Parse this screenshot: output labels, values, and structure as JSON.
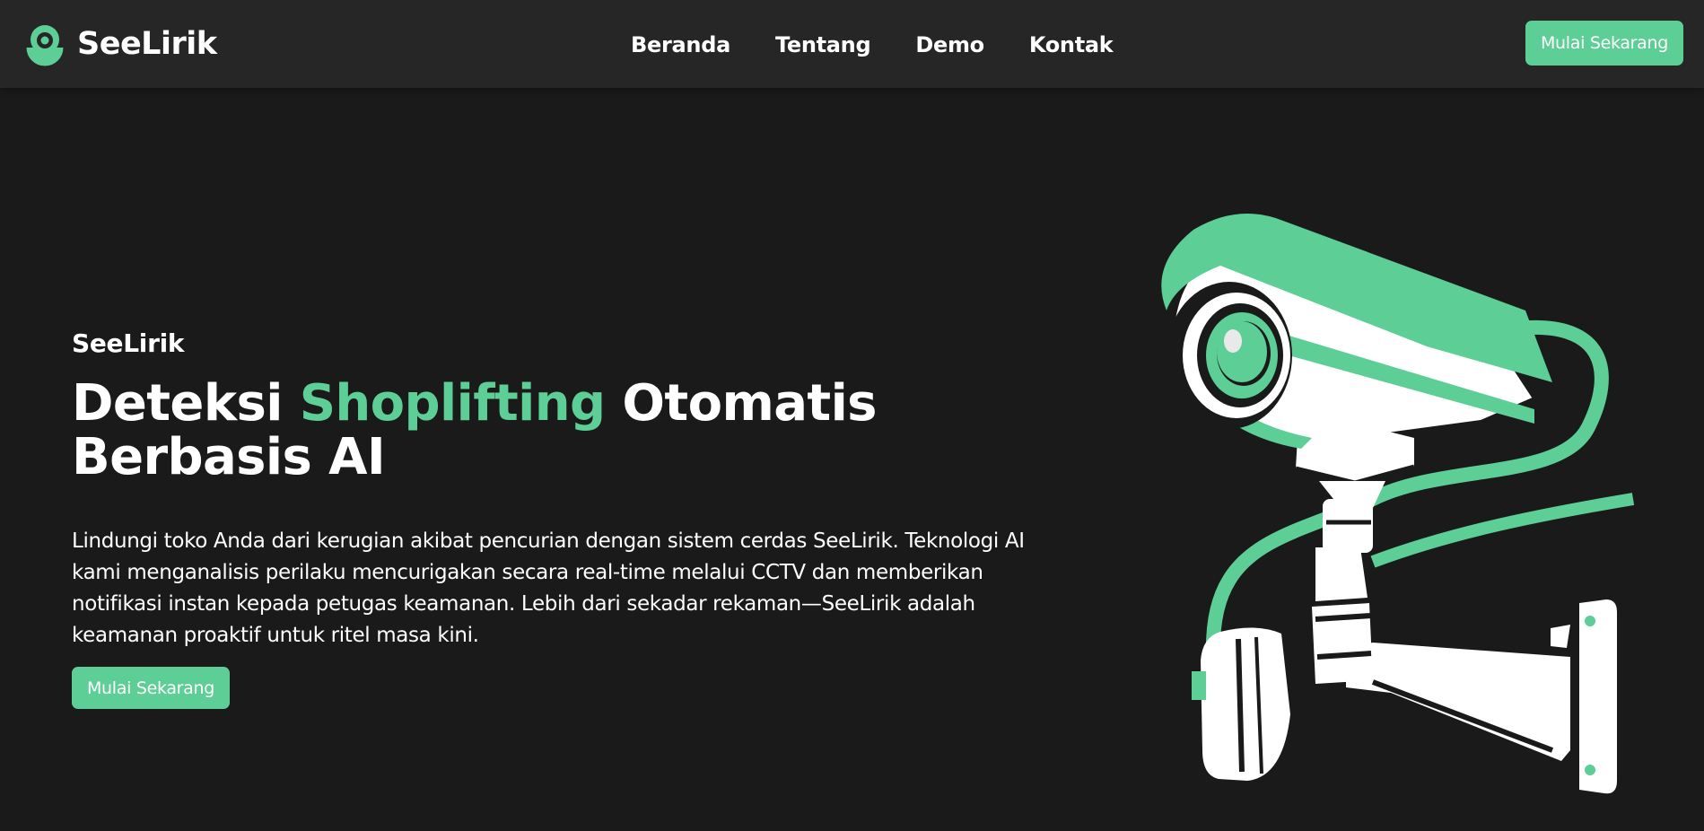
{
  "brand": {
    "name": "SeeLirik",
    "logo_icon": "eye-logo-icon",
    "accent_color": "#5cce96"
  },
  "nav": {
    "items": [
      {
        "label": "Beranda"
      },
      {
        "label": "Tentang"
      },
      {
        "label": "Demo"
      },
      {
        "label": "Kontak"
      }
    ],
    "cta_label": "Mulai Sekarang"
  },
  "hero": {
    "eyebrow": "SeeLirik",
    "title_part1": "Deteksi ",
    "title_accent": "Shoplifting",
    "title_part2": " Otomatis Berbasis AI",
    "description": "Lindungi toko Anda dari kerugian akibat pencurian dengan sistem cerdas SeeLirik. Teknologi AI kami menganalisis perilaku mencurigakan secara real-time melalui CCTV dan memberikan notifikasi instan kepada petugas keamanan. Lebih dari sekadar rekaman—SeeLirik adalah keamanan proaktif untuk ritel masa kini.",
    "cta_label": "Mulai Sekarang",
    "illustration_icon": "cctv-camera-icon"
  },
  "colors": {
    "background": "#1a1a1a",
    "navbar": "#262626",
    "accent": "#5cce96",
    "text": "#ffffff"
  }
}
